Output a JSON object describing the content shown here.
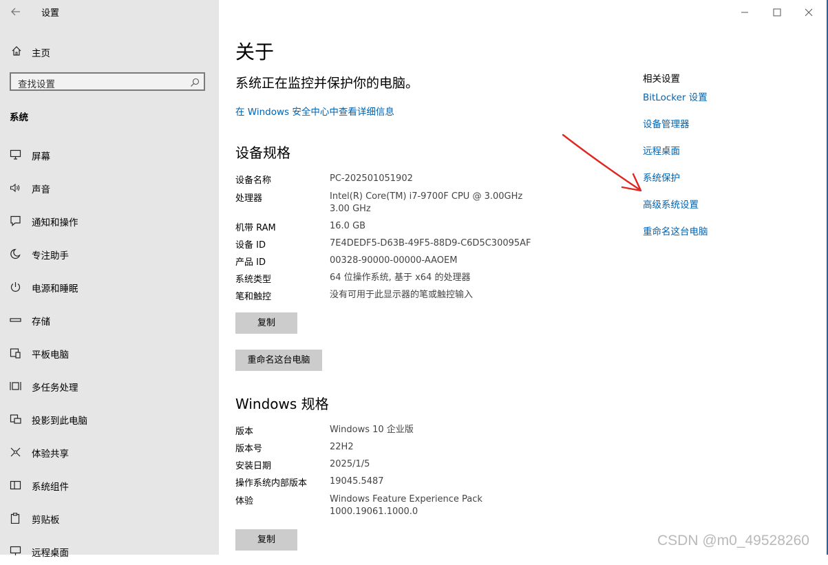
{
  "window": {
    "title": "设置"
  },
  "sidebar": {
    "home_label": "主页",
    "search_placeholder": "查找设置",
    "section_label": "系统",
    "items": [
      {
        "label": "屏幕",
        "icon": "monitor-icon"
      },
      {
        "label": "声音",
        "icon": "speaker-icon"
      },
      {
        "label": "通知和操作",
        "icon": "notification-icon"
      },
      {
        "label": "专注助手",
        "icon": "moon-icon"
      },
      {
        "label": "电源和睡眠",
        "icon": "power-icon"
      },
      {
        "label": "存储",
        "icon": "storage-icon"
      },
      {
        "label": "平板电脑",
        "icon": "tablet-icon"
      },
      {
        "label": "多任务处理",
        "icon": "multitask-icon"
      },
      {
        "label": "投影到此电脑",
        "icon": "project-icon"
      },
      {
        "label": "体验共享",
        "icon": "share-icon"
      },
      {
        "label": "系统组件",
        "icon": "components-icon"
      },
      {
        "label": "剪贴板",
        "icon": "clipboard-icon"
      },
      {
        "label": "远程桌面",
        "icon": "remote-desktop-icon"
      }
    ]
  },
  "main": {
    "title": "关于",
    "status": "系统正在监控并保护你的电脑。",
    "security_link": "在 Windows 安全中心中查看详细信息",
    "device_specs": {
      "heading": "设备规格",
      "rows": [
        {
          "label": "设备名称",
          "value": "PC-202501051902"
        },
        {
          "label": "处理器",
          "value": "Intel(R) Core(TM) i7-9700F CPU @ 3.00GHz   3.00 GHz"
        },
        {
          "label": "机带 RAM",
          "value": "16.0 GB"
        },
        {
          "label": "设备 ID",
          "value": "7E4DEDF5-D63B-49F5-88D9-C6D5C30095AF"
        },
        {
          "label": "产品 ID",
          "value": "00328-90000-00000-AAOEM"
        },
        {
          "label": "系统类型",
          "value": "64 位操作系统, 基于 x64 的处理器"
        },
        {
          "label": "笔和触控",
          "value": "没有可用于此显示器的笔或触控输入"
        }
      ],
      "copy_button": "复制",
      "rename_button": "重命名这台电脑"
    },
    "windows_specs": {
      "heading": "Windows 规格",
      "rows": [
        {
          "label": "版本",
          "value": "Windows 10 企业版"
        },
        {
          "label": "版本号",
          "value": "22H2"
        },
        {
          "label": "安装日期",
          "value": "2025/1/5"
        },
        {
          "label": "操作系统内部版本",
          "value": "19045.5487"
        },
        {
          "label": "体验",
          "value": "Windows Feature Experience Pack 1000.19061.1000.0"
        }
      ],
      "copy_button": "复制"
    }
  },
  "related": {
    "title": "相关设置",
    "links": [
      "BitLocker 设置",
      "设备管理器",
      "远程桌面",
      "系统保护",
      "高级系统设置",
      "重命名这台电脑"
    ]
  },
  "watermark": "CSDN @m0_49528260",
  "colors": {
    "sidebar_bg": "#e6e6e6",
    "link": "#0063b1",
    "annotation_arrow": "#e0261f",
    "button_bg": "#cccccc"
  }
}
